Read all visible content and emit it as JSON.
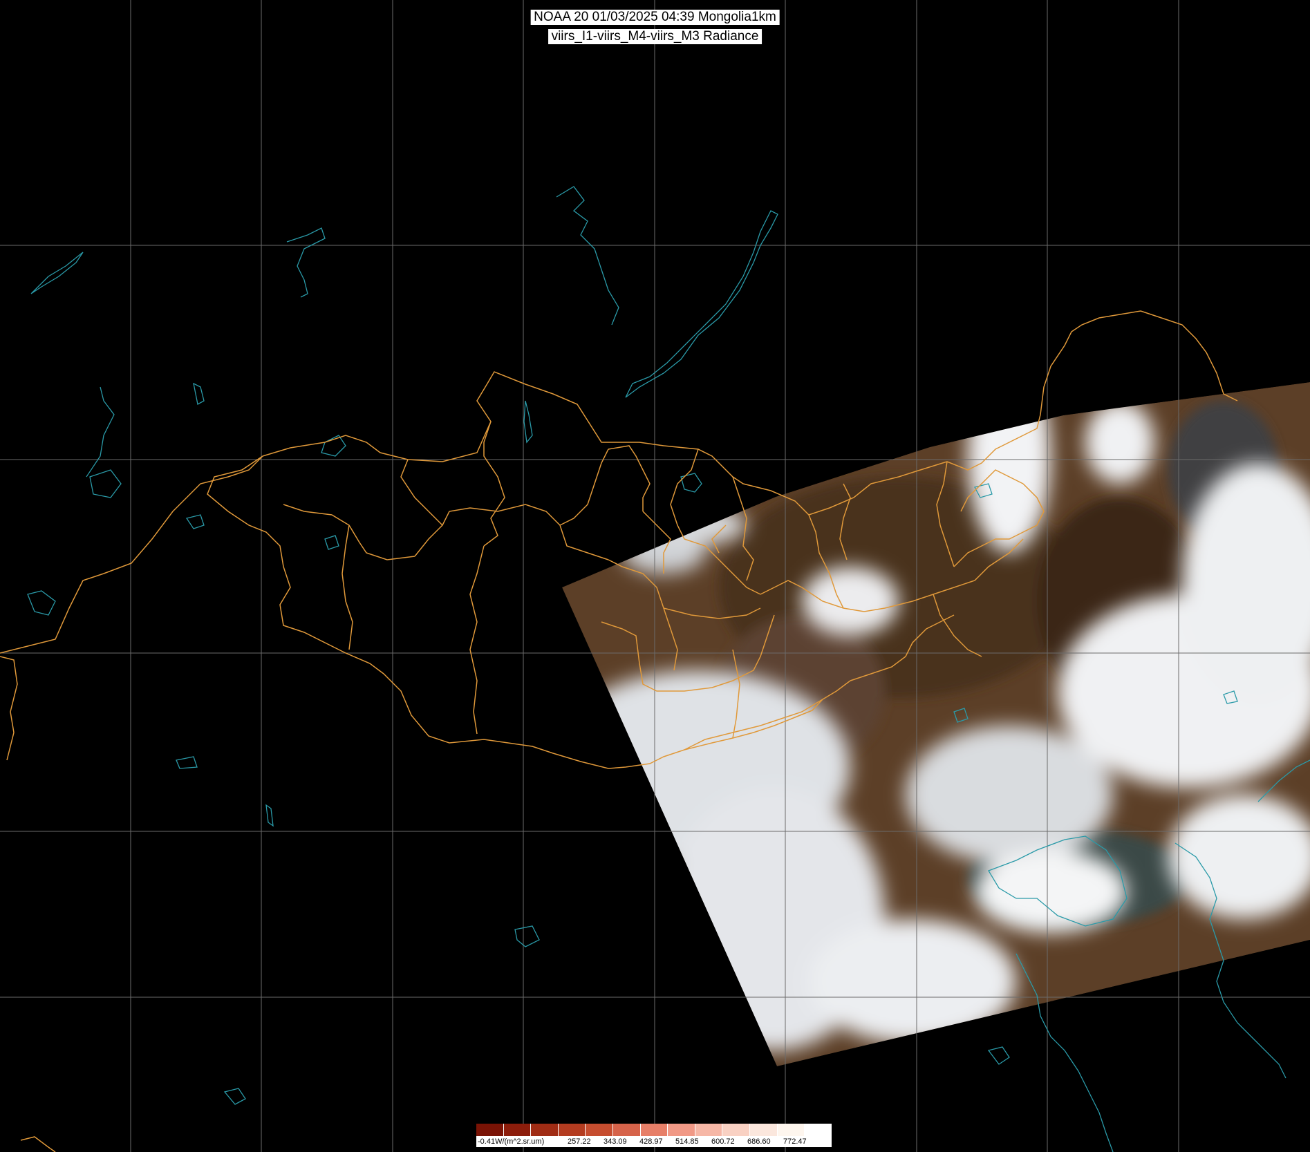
{
  "header": {
    "line1": "NOAA 20 01/03/2025 04:39 Mongolia1km",
    "line2": "viirs_I1-viirs_M4-viirs_M3 Radiance"
  },
  "colors": {
    "background": "#000000",
    "grid": "#6b6b6b",
    "border": "#e0993a",
    "coast": "#2a9aa8",
    "land": "#5a3d26",
    "cloud": "#e8eaec"
  },
  "colorbar": {
    "unit_label": "-0.41W/(m^2.sr.um)",
    "ticks": [
      "257.22",
      "343.09",
      "428.97",
      "514.85",
      "600.72",
      "686.60",
      "772.47"
    ],
    "colors": [
      "#7a1305",
      "#8d1d0b",
      "#a02c14",
      "#b43c20",
      "#c64d2f",
      "#d6634a",
      "#e77f68",
      "#f19986",
      "#f6b7a6",
      "#f9d1c3",
      "#fbe7dd",
      "#fef6ee",
      "#ffffff"
    ]
  }
}
